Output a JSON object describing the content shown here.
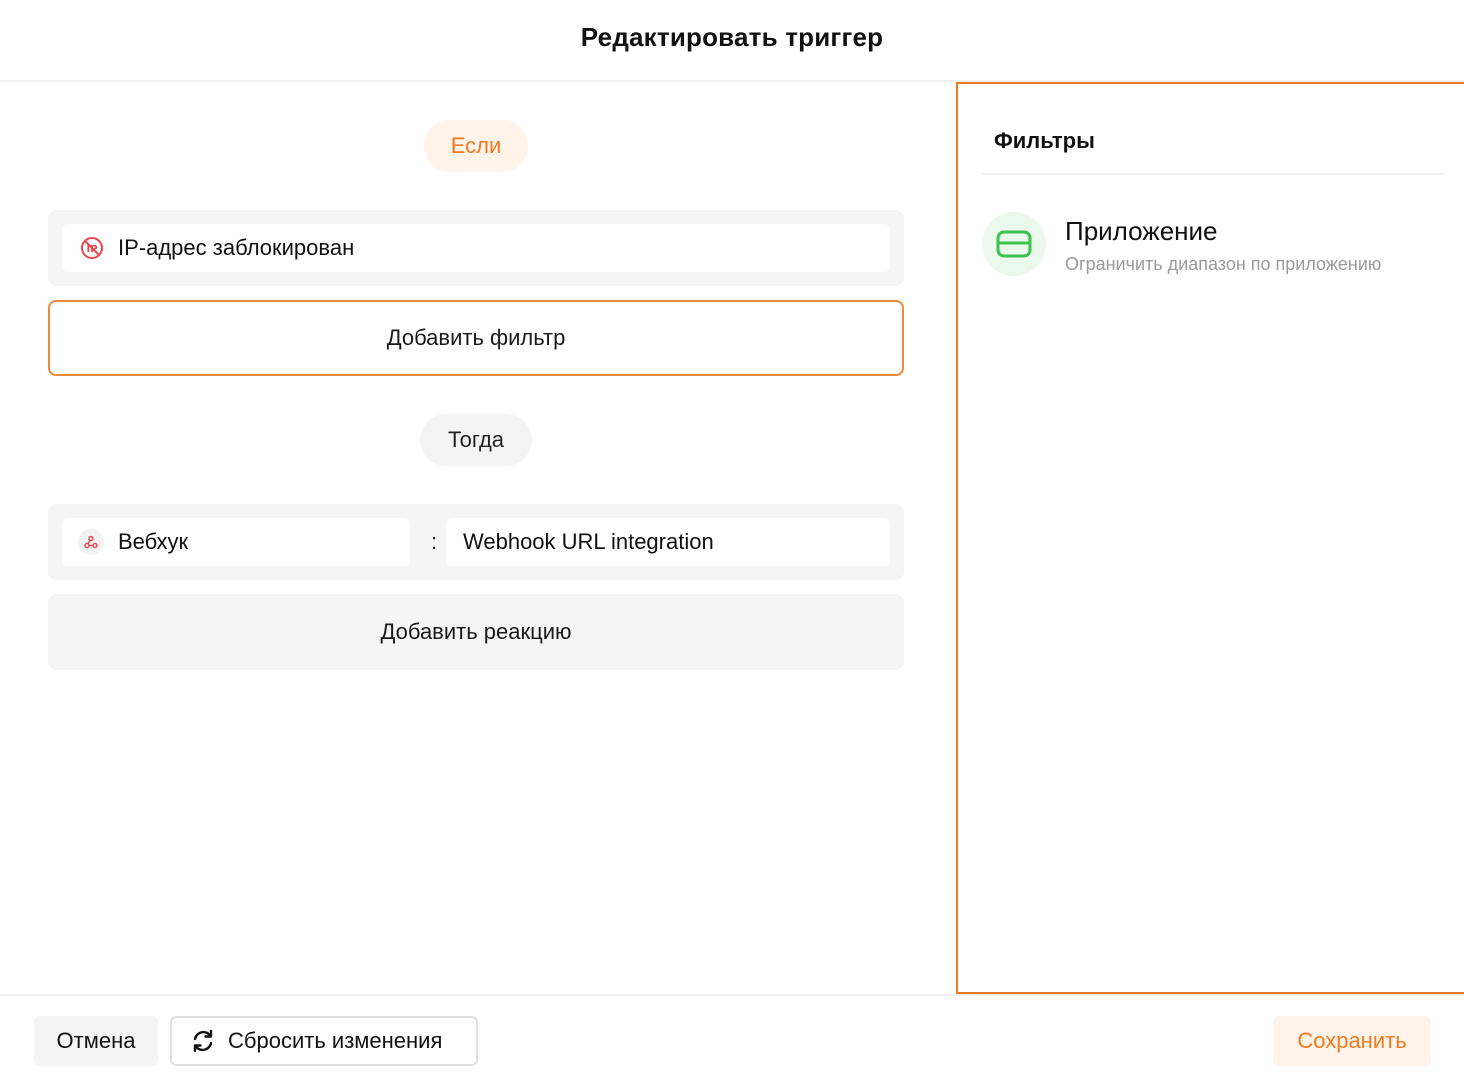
{
  "dialog": {
    "title": "Редактировать триггер"
  },
  "editor": {
    "if_label": "Если",
    "condition": {
      "icon": "ip-blocked-icon",
      "label": "IP-адрес заблокирован"
    },
    "add_filter_label": "Добавить фильтр",
    "then_label": "Тогда",
    "reaction": {
      "type_icon": "webhook-icon",
      "type_label": "Вебхук",
      "separator": ":",
      "target": "Webhook URL integration"
    },
    "add_reaction_label": "Добавить реакцию"
  },
  "filters_panel": {
    "title": "Фильтры",
    "items": [
      {
        "icon": "application-card-icon",
        "name": "Приложение",
        "description": "Ограничить диапазон по приложению"
      }
    ]
  },
  "footer": {
    "cancel_label": "Отмена",
    "reset_label": "Сбросить изменения",
    "reset_icon": "refresh-icon",
    "save_label": "Сохранить"
  },
  "colors": {
    "accent": "#f07a22",
    "accent_soft": "#fff3ea",
    "panel_bg": "#f5f5f5",
    "success_soft": "#ebf8ec",
    "success": "#3cc14a",
    "danger": "#e5484d"
  }
}
